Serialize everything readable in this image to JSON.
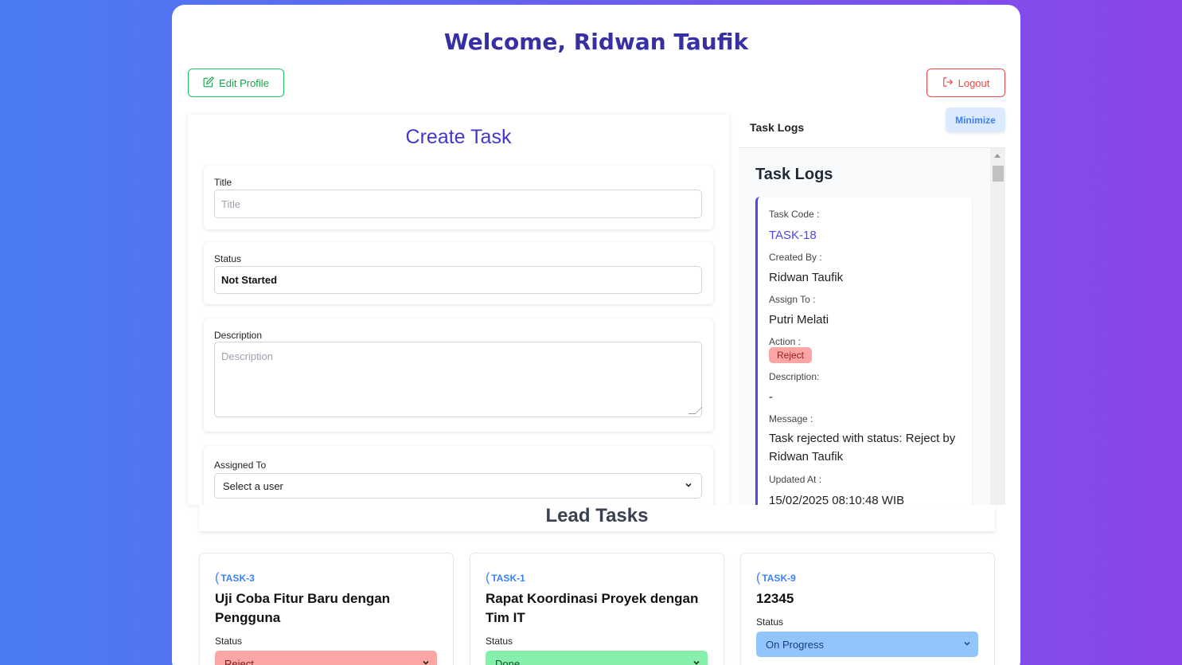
{
  "header": {
    "welcome": "Welcome, Ridwan Taufik",
    "edit_profile": "Edit Profile",
    "logout": "Logout"
  },
  "create_task": {
    "title": "Create Task",
    "fields": {
      "title_label": "Title",
      "title_placeholder": "Title",
      "status_label": "Status",
      "status_value": "Not Started",
      "description_label": "Description",
      "description_placeholder": "Description",
      "assigned_label": "Assigned To",
      "assigned_value": "Select a user"
    }
  },
  "task_logs": {
    "header_title": "Task Logs",
    "minimize": "Minimize",
    "body_title": "Task Logs",
    "entry": {
      "task_code_label": "Task Code :",
      "task_code": "TASK-18",
      "created_by_label": "Created By :",
      "created_by": "Ridwan Taufik",
      "assign_to_label": "Assign To :",
      "assign_to": "Putri Melati",
      "action_label": "Action :",
      "action": "Reject",
      "description_label": "Description:",
      "description": "-",
      "message_label": "Message :",
      "message": "Task rejected with status: Reject by Ridwan Taufik",
      "updated_at_label": "Updated At :",
      "updated_at": "15/02/2025 08:10:48 WIB"
    }
  },
  "lead_tasks": {
    "title": "Lead Tasks",
    "cards": [
      {
        "code": "TASK-3",
        "title": "Uji Coba Fitur Baru dengan Pengguna",
        "status_label": "Status",
        "status": "Reject"
      },
      {
        "code": "TASK-1",
        "title": "Rapat Koordinasi Proyek dengan Tim IT",
        "status_label": "Status",
        "status": "Done"
      },
      {
        "code": "TASK-9",
        "title": "12345",
        "status_label": "Status",
        "status": "On Progress"
      }
    ]
  },
  "colors": {
    "reject": "#fca5a5",
    "done": "#86efac",
    "on_progress": "#93c5fd",
    "accent": "#4338ca"
  },
  "icons": {
    "edit": "edit-icon",
    "logout": "logout-icon",
    "chevron": "chevron-down-icon"
  }
}
